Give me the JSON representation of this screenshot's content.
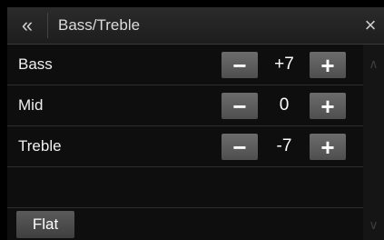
{
  "header": {
    "back_icon": "double-chevron-left-icon",
    "back_glyph": "«",
    "title": "Bass/Treble",
    "close_icon": "close-icon",
    "close_glyph": "×"
  },
  "rows": [
    {
      "label": "Bass",
      "value": "+7",
      "minus_glyph": "−",
      "plus_glyph": "+"
    },
    {
      "label": "Mid",
      "value": "0",
      "minus_glyph": "−",
      "plus_glyph": "+"
    },
    {
      "label": "Treble",
      "value": "-7",
      "minus_glyph": "−",
      "plus_glyph": "+"
    }
  ],
  "scroll": {
    "up_icon": "chevron-up-icon",
    "up_glyph": "∧",
    "down_icon": "chevron-down-icon",
    "down_glyph": "∨"
  },
  "footer": {
    "flat_label": "Flat"
  },
  "colors": {
    "background": "#0e0e0e",
    "button": "#5f5f5f",
    "text": "#f2f2f2"
  }
}
